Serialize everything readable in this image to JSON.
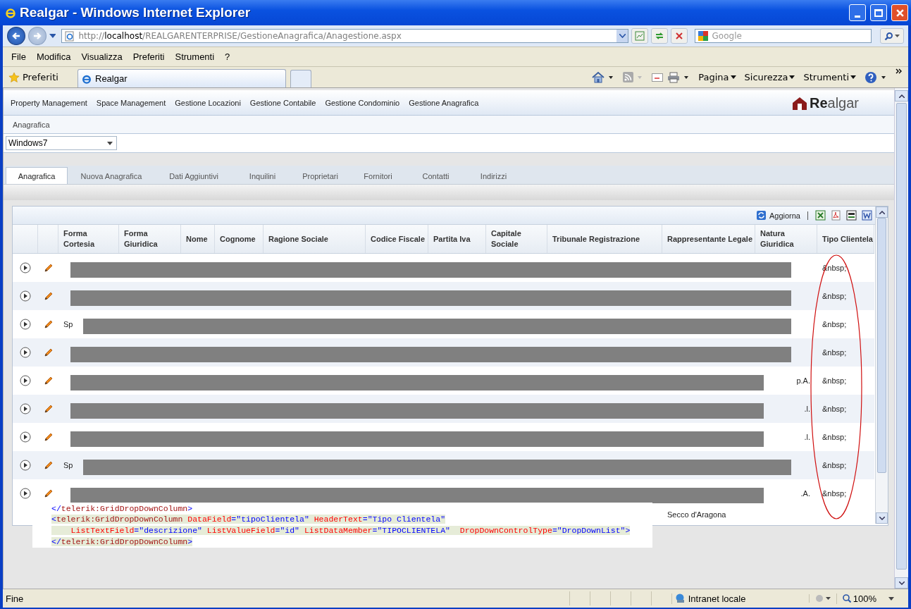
{
  "window": {
    "title": "Realgar - Windows Internet Explorer"
  },
  "address_bar": {
    "scheme": "http://",
    "host": "localhost",
    "path": "/REALGARENTERPRISE/GestioneAnagrafica/Anagestione.aspx"
  },
  "search": {
    "placeholder": "Google"
  },
  "menu": [
    "File",
    "Modifica",
    "Visualizza",
    "Preferiti",
    "Strumenti",
    "?"
  ],
  "favorites": {
    "label": "Preferiti"
  },
  "browser_tabs": [
    {
      "label": "Realgar",
      "selected": true
    }
  ],
  "command_bar": [
    "Pagina",
    "Sicurezza",
    "Strumenti"
  ],
  "app": {
    "nav": [
      "Property Management",
      "Space Management",
      "Gestione Locazioni",
      "Gestione Contabile",
      "Gestione Condominio",
      "Gestione Anagrafica"
    ],
    "logo": {
      "strong": "Re",
      "rest": "algar"
    },
    "breadcrumb": "Anagrafica",
    "skin_select": "Windows7",
    "tabs": [
      {
        "label": "Anagrafica",
        "selected": true
      },
      {
        "label": "Nuova Anagrafica",
        "selected": false
      },
      {
        "label": "Dati Aggiuntivi",
        "selected": false
      },
      {
        "label": "Inquilini",
        "selected": false
      },
      {
        "label": "Proprietari",
        "selected": false
      },
      {
        "label": "Fornitori",
        "selected": false
      },
      {
        "label": "Contatti",
        "selected": false
      },
      {
        "label": "Indirizzi",
        "selected": false
      }
    ]
  },
  "grid": {
    "refresh": "Aggiorna",
    "columns": [
      "Forma Cortesia",
      "Forma Giuridica",
      "Nome",
      "Cognome",
      "Ragione Sociale",
      "Codice Fiscale",
      "Partita Iva",
      "Capitale Sociale",
      "Tribunale Registrazione",
      "Rappresentante Legale",
      "Natura Giuridica",
      "Tipo Clientela"
    ],
    "rows": [
      {
        "tipo": "&nbsp;"
      },
      {
        "tipo": "&nbsp;"
      },
      {
        "start": "Sp",
        "tipo": "&nbsp;"
      },
      {
        "tipo": "&nbsp;"
      },
      {
        "natura": "p.A.",
        "tipo": "&nbsp;"
      },
      {
        "natura": ".l.",
        "tipo": "&nbsp;"
      },
      {
        "natura": ".l.",
        "tipo": "&nbsp;"
      },
      {
        "start": "Sp",
        "tipo": "&nbsp;"
      },
      {
        "natura": ".A.",
        "tipo": "&nbsp;"
      }
    ],
    "partial_row": {
      "rappresentante": "Secco d'Aragona"
    }
  },
  "code_snippet": [
    [
      {
        "kind": "punct",
        "text": "</"
      },
      {
        "kind": "tag",
        "text": "telerik:GridDropDownColumn"
      },
      {
        "kind": "punct",
        "text": ">"
      }
    ],
    [
      {
        "kind": "punct",
        "text": "<"
      },
      {
        "kind": "tag",
        "text": "telerik:GridDropDownColumn"
      },
      {
        "kind": "attr",
        "text": " DataField"
      },
      {
        "kind": "punct",
        "text": "="
      },
      {
        "kind": "value",
        "text": "\"tipoClientela\""
      },
      {
        "kind": "attr",
        "text": " HeaderText"
      },
      {
        "kind": "punct",
        "text": "="
      },
      {
        "kind": "value",
        "text": "\"Tipo Clientela\""
      }
    ],
    [
      {
        "kind": "attr",
        "text": "    ListTextField"
      },
      {
        "kind": "punct",
        "text": "="
      },
      {
        "kind": "value",
        "text": "\"descrizione\""
      },
      {
        "kind": "attr",
        "text": " ListValueField"
      },
      {
        "kind": "punct",
        "text": "="
      },
      {
        "kind": "value",
        "text": "\"id\""
      },
      {
        "kind": "attr",
        "text": " ListDataMember"
      },
      {
        "kind": "punct",
        "text": "="
      },
      {
        "kind": "value",
        "text": "\"TIPOCLIENTELA\""
      },
      {
        "kind": "attr",
        "text": "  DropDownControlType"
      },
      {
        "kind": "punct",
        "text": "="
      },
      {
        "kind": "value",
        "text": "\"DropDownList\""
      },
      {
        "kind": "punct",
        "text": ">"
      }
    ],
    [
      {
        "kind": "punct",
        "text": "</"
      },
      {
        "kind": "tag",
        "text": "telerik:GridDropDownColumn"
      },
      {
        "kind": "punct",
        "text": ">"
      }
    ]
  ],
  "status_bar": {
    "text": "Fine",
    "zone": "Intranet locale",
    "zoom": "100%"
  }
}
